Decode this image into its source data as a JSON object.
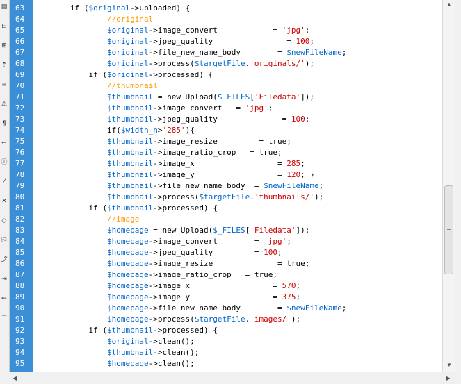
{
  "toolbar": {
    "buttons": [
      "open-documents-icon",
      "collapse-icon",
      "expand-icon",
      "select-parent-icon",
      "line-numbers-icon",
      "highlight-invalid-icon",
      "syntax-coloring-icon",
      "word-wrap-icon",
      "info-icon",
      "apply-comment-icon",
      "remove-comment-icon",
      "wrap-tag-icon",
      "recent-snippets-icon",
      "move-css-icon",
      "indent-icon",
      "outdent-icon",
      "format-source-icon"
    ]
  },
  "editor": {
    "line_numbers": [
      "63",
      "64",
      "65",
      "66",
      "67",
      "68",
      "69",
      "70",
      "71",
      "72",
      "73",
      "74",
      "75",
      "76",
      "77",
      "78",
      "79",
      "80",
      "81",
      "82",
      "83",
      "84",
      "85",
      "86",
      "87",
      "88",
      "89",
      "90",
      "91",
      "92",
      "93",
      "94",
      "95"
    ],
    "lines": [
      [
        {
          "t": "        if (",
          "c": "kw"
        },
        {
          "t": "$original",
          "c": "var"
        },
        {
          "t": "->uploaded) {",
          "c": "kw"
        }
      ],
      [
        {
          "t": "                ",
          "c": "kw"
        },
        {
          "t": "//original",
          "c": "cmt"
        }
      ],
      [
        {
          "t": "                ",
          "c": "kw"
        },
        {
          "t": "$original",
          "c": "var"
        },
        {
          "t": "->image_convert            = ",
          "c": "kw"
        },
        {
          "t": "'jpg'",
          "c": "str"
        },
        {
          "t": ";",
          "c": "kw"
        }
      ],
      [
        {
          "t": "                ",
          "c": "kw"
        },
        {
          "t": "$original",
          "c": "var"
        },
        {
          "t": "->jpeg_quality                = ",
          "c": "kw"
        },
        {
          "t": "100",
          "c": "num"
        },
        {
          "t": ";",
          "c": "kw"
        }
      ],
      [
        {
          "t": "                ",
          "c": "kw"
        },
        {
          "t": "$original",
          "c": "var"
        },
        {
          "t": "->file_new_name_body        = ",
          "c": "kw"
        },
        {
          "t": "$newFileName",
          "c": "var"
        },
        {
          "t": ";",
          "c": "kw"
        }
      ],
      [
        {
          "t": "                ",
          "c": "kw"
        },
        {
          "t": "$original",
          "c": "var"
        },
        {
          "t": "->process(",
          "c": "kw"
        },
        {
          "t": "$targetFile",
          "c": "var"
        },
        {
          "t": ".",
          "c": "kw"
        },
        {
          "t": "'originals/'",
          "c": "str"
        },
        {
          "t": ");",
          "c": "kw"
        }
      ],
      [
        {
          "t": "            if (",
          "c": "kw"
        },
        {
          "t": "$original",
          "c": "var"
        },
        {
          "t": "->processed) {",
          "c": "kw"
        }
      ],
      [
        {
          "t": "                ",
          "c": "kw"
        },
        {
          "t": "//thumbnail",
          "c": "cmt"
        }
      ],
      [
        {
          "t": "                ",
          "c": "kw"
        },
        {
          "t": "$thumbnail",
          "c": "var"
        },
        {
          "t": " = new Upload(",
          "c": "kw"
        },
        {
          "t": "$_FILES",
          "c": "var"
        },
        {
          "t": "[",
          "c": "kw"
        },
        {
          "t": "'Filedata'",
          "c": "str"
        },
        {
          "t": "]);",
          "c": "kw"
        }
      ],
      [
        {
          "t": "                ",
          "c": "kw"
        },
        {
          "t": "$thumbnail",
          "c": "var"
        },
        {
          "t": "->image_convert   = ",
          "c": "kw"
        },
        {
          "t": "'jpg'",
          "c": "str"
        },
        {
          "t": ";",
          "c": "kw"
        }
      ],
      [
        {
          "t": "                ",
          "c": "kw"
        },
        {
          "t": "$thumbnail",
          "c": "var"
        },
        {
          "t": "->jpeg_quality              = ",
          "c": "kw"
        },
        {
          "t": "100",
          "c": "num"
        },
        {
          "t": ";",
          "c": "kw"
        }
      ],
      [
        {
          "t": "                if(",
          "c": "kw"
        },
        {
          "t": "$width_n",
          "c": "var"
        },
        {
          "t": ">",
          "c": "kw"
        },
        {
          "t": "'285'",
          "c": "str"
        },
        {
          "t": "){",
          "c": "kw"
        }
      ],
      [
        {
          "t": "                ",
          "c": "kw"
        },
        {
          "t": "$thumbnail",
          "c": "var"
        },
        {
          "t": "->image_resize         = ",
          "c": "kw"
        },
        {
          "t": "true",
          "c": "kw"
        },
        {
          "t": ";",
          "c": "kw"
        }
      ],
      [
        {
          "t": "                ",
          "c": "kw"
        },
        {
          "t": "$thumbnail",
          "c": "var"
        },
        {
          "t": "->image_ratio_crop   = ",
          "c": "kw"
        },
        {
          "t": "true",
          "c": "kw"
        },
        {
          "t": ";",
          "c": "kw"
        }
      ],
      [
        {
          "t": "                ",
          "c": "kw"
        },
        {
          "t": "$thumbnail",
          "c": "var"
        },
        {
          "t": "->image_x                  = ",
          "c": "kw"
        },
        {
          "t": "285",
          "c": "num"
        },
        {
          "t": ";",
          "c": "kw"
        }
      ],
      [
        {
          "t": "                ",
          "c": "kw"
        },
        {
          "t": "$thumbnail",
          "c": "var"
        },
        {
          "t": "->image_y                  = ",
          "c": "kw"
        },
        {
          "t": "120",
          "c": "num"
        },
        {
          "t": "; }",
          "c": "kw"
        }
      ],
      [
        {
          "t": "                ",
          "c": "kw"
        },
        {
          "t": "$thumbnail",
          "c": "var"
        },
        {
          "t": "->file_new_name_body  = ",
          "c": "kw"
        },
        {
          "t": "$newFileName",
          "c": "var"
        },
        {
          "t": ";",
          "c": "kw"
        }
      ],
      [
        {
          "t": "                ",
          "c": "kw"
        },
        {
          "t": "$thumbnail",
          "c": "var"
        },
        {
          "t": "->process(",
          "c": "kw"
        },
        {
          "t": "$targetFile",
          "c": "var"
        },
        {
          "t": ".",
          "c": "kw"
        },
        {
          "t": "'thumbnails/'",
          "c": "str"
        },
        {
          "t": ");",
          "c": "kw"
        }
      ],
      [
        {
          "t": "            if (",
          "c": "kw"
        },
        {
          "t": "$thumbnail",
          "c": "var"
        },
        {
          "t": "->processed) {",
          "c": "kw"
        }
      ],
      [
        {
          "t": "                ",
          "c": "kw"
        },
        {
          "t": "//image",
          "c": "cmt"
        }
      ],
      [
        {
          "t": "                ",
          "c": "kw"
        },
        {
          "t": "$homepage",
          "c": "var"
        },
        {
          "t": " = new Upload(",
          "c": "kw"
        },
        {
          "t": "$_FILES",
          "c": "var"
        },
        {
          "t": "[",
          "c": "kw"
        },
        {
          "t": "'Filedata'",
          "c": "str"
        },
        {
          "t": "]);",
          "c": "kw"
        }
      ],
      [
        {
          "t": "                ",
          "c": "kw"
        },
        {
          "t": "$homepage",
          "c": "var"
        },
        {
          "t": "->image_convert        = ",
          "c": "kw"
        },
        {
          "t": "'jpg'",
          "c": "str"
        },
        {
          "t": ";",
          "c": "kw"
        }
      ],
      [
        {
          "t": "                ",
          "c": "kw"
        },
        {
          "t": "$homepage",
          "c": "var"
        },
        {
          "t": "->jpeg_quality         = ",
          "c": "kw"
        },
        {
          "t": "100",
          "c": "num"
        },
        {
          "t": ";",
          "c": "kw"
        }
      ],
      [
        {
          "t": "                ",
          "c": "kw"
        },
        {
          "t": "$homepage",
          "c": "var"
        },
        {
          "t": "->image_resize              = ",
          "c": "kw"
        },
        {
          "t": "true",
          "c": "kw"
        },
        {
          "t": ";",
          "c": "kw"
        }
      ],
      [
        {
          "t": "                ",
          "c": "kw"
        },
        {
          "t": "$homepage",
          "c": "var"
        },
        {
          "t": "->image_ratio_crop   = ",
          "c": "kw"
        },
        {
          "t": "true",
          "c": "kw"
        },
        {
          "t": ";",
          "c": "kw"
        }
      ],
      [
        {
          "t": "                ",
          "c": "kw"
        },
        {
          "t": "$homepage",
          "c": "var"
        },
        {
          "t": "->image_x                  = ",
          "c": "kw"
        },
        {
          "t": "570",
          "c": "num"
        },
        {
          "t": ";",
          "c": "kw"
        }
      ],
      [
        {
          "t": "                ",
          "c": "kw"
        },
        {
          "t": "$homepage",
          "c": "var"
        },
        {
          "t": "->image_y                  = ",
          "c": "kw"
        },
        {
          "t": "375",
          "c": "num"
        },
        {
          "t": ";",
          "c": "kw"
        }
      ],
      [
        {
          "t": "                ",
          "c": "kw"
        },
        {
          "t": "$homepage",
          "c": "var"
        },
        {
          "t": "->file_new_name_body        = ",
          "c": "kw"
        },
        {
          "t": "$newFileName",
          "c": "var"
        },
        {
          "t": ";",
          "c": "kw"
        }
      ],
      [
        {
          "t": "                ",
          "c": "kw"
        },
        {
          "t": "$homepage",
          "c": "var"
        },
        {
          "t": "->process(",
          "c": "kw"
        },
        {
          "t": "$targetFile",
          "c": "var"
        },
        {
          "t": ".",
          "c": "kw"
        },
        {
          "t": "'images/'",
          "c": "str"
        },
        {
          "t": ");",
          "c": "kw"
        }
      ],
      [
        {
          "t": "            if (",
          "c": "kw"
        },
        {
          "t": "$thumbnail",
          "c": "var"
        },
        {
          "t": "->processed) {",
          "c": "kw"
        }
      ],
      [
        {
          "t": "                ",
          "c": "kw"
        },
        {
          "t": "$original",
          "c": "var"
        },
        {
          "t": "->clean();",
          "c": "kw"
        }
      ],
      [
        {
          "t": "                ",
          "c": "kw"
        },
        {
          "t": "$thumbnail",
          "c": "var"
        },
        {
          "t": "->clean();",
          "c": "kw"
        }
      ],
      [
        {
          "t": "                ",
          "c": "kw"
        },
        {
          "t": "$homepage",
          "c": "var"
        },
        {
          "t": "->clean();",
          "c": "kw"
        }
      ]
    ]
  },
  "colors": {
    "gutter": "#3a8fd6",
    "comment": "#ff9900",
    "variable": "#0066cc",
    "string": "#cc0000",
    "number": "#cc0000"
  },
  "scrollbars": {
    "vertical_position": 0.52,
    "up_arrow": "▲",
    "down_arrow": "▼",
    "left_arrow": "◀",
    "right_arrow": "▶"
  }
}
